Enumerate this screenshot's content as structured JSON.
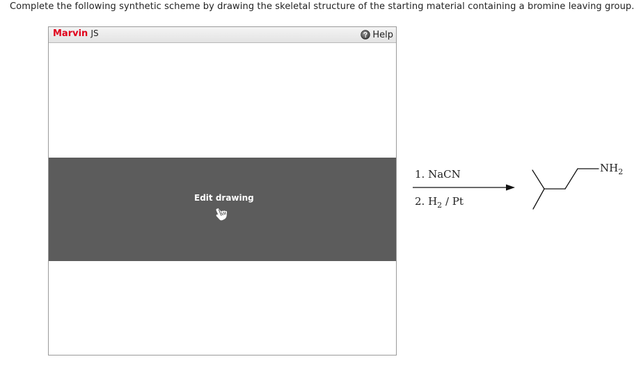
{
  "question": {
    "text": "Complete the following synthetic scheme by drawing the skeletal structure of the starting material containing a bromine leaving group."
  },
  "marvin": {
    "brand_strong": "Marvin",
    "brand_rest": "JS",
    "help_label": "Help",
    "edit_label": "Edit drawing",
    "overlay_color": "#5c5c5c",
    "brand_color": "#e0001a"
  },
  "scheme": {
    "step1_prefix": "1. NaCN",
    "step2_prefix": "2. H",
    "step2_sub": "2",
    "step2_suffix": " / Pt",
    "product_group": "NH",
    "product_group_sub": "2"
  },
  "icons": {
    "help": "help-circle-icon",
    "edit": "hand-pointer-icon",
    "arrow": "reaction-arrow-icon"
  }
}
